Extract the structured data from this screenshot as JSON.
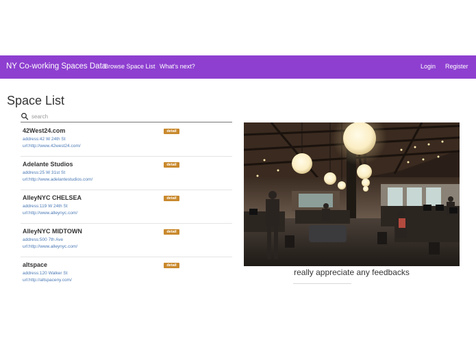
{
  "navbar": {
    "brand": "NY Co-working Spaces Data",
    "links": [
      "Browse Space List",
      "What's next?"
    ],
    "right_links": [
      "Login",
      "Register"
    ],
    "color": "#8e3fd0"
  },
  "page": {
    "title": "Space List"
  },
  "search": {
    "placeholder": "search",
    "icon": "search-icon"
  },
  "spaces": [
    {
      "name": "42West24.com",
      "address": "address:42 W 24th St",
      "url": "url:http://www.42west24.com/",
      "button": "detail"
    },
    {
      "name": "Adelante Studios",
      "address": "address:25 W 31st St",
      "url": "url:http://www.adelantestudios.com/",
      "button": "detail"
    },
    {
      "name": "AlleyNYC CHELSEA",
      "address": "address:119 W 24th St",
      "url": "url:http://www.alleynyc.com/",
      "button": "detail"
    },
    {
      "name": "AlleyNYC MIDTOWN",
      "address": "address:500 7th Ave",
      "url": "url:http://www.alleynyc.com/",
      "button": "detail"
    },
    {
      "name": "altspace",
      "address": "address:120 Walker St",
      "url": "url:http://altspaceny.com/",
      "button": "detail"
    }
  ],
  "feature": {
    "caption": "really appreciate any feedbacks"
  },
  "colors": {
    "link": "#4a79b5",
    "detail_button": "#c9892d"
  }
}
